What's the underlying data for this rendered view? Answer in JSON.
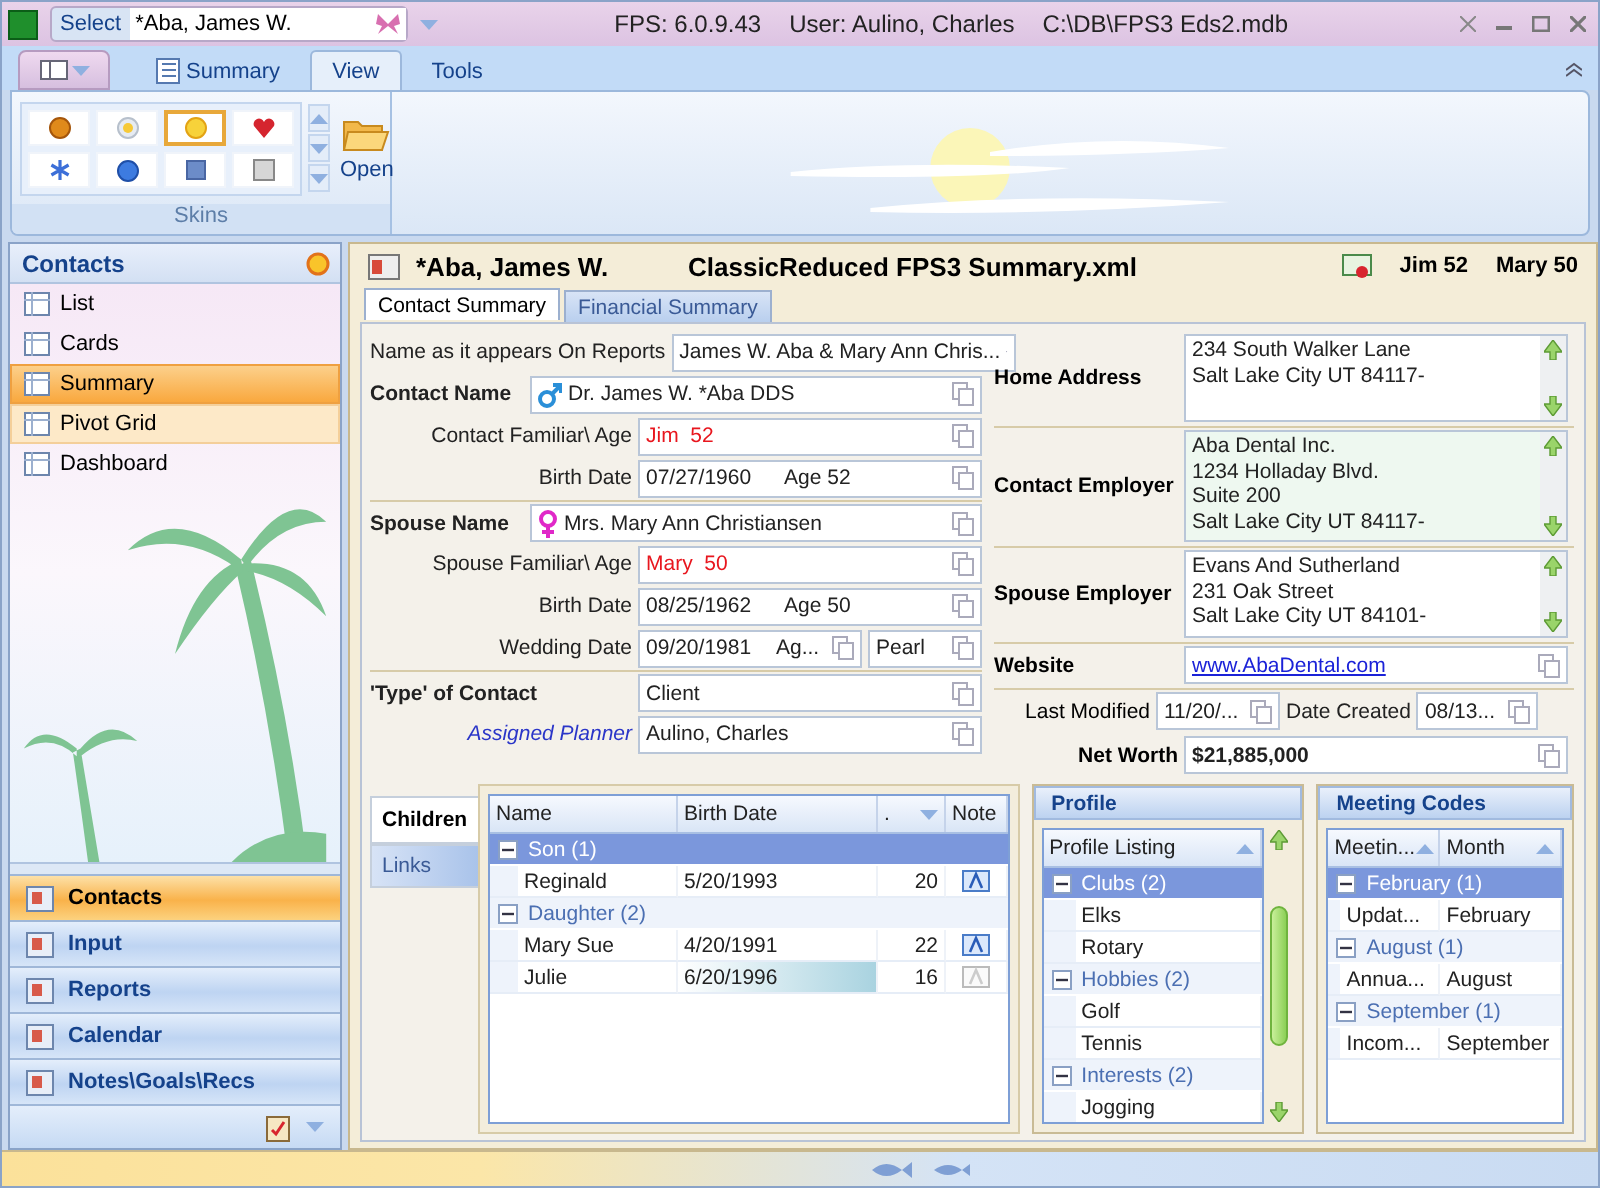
{
  "title_bar": {
    "select_label": "Select",
    "select_value": "*Aba, James W.",
    "version": "FPS: 6.0.9.43",
    "user": "User: Aulino, Charles",
    "path": "C:\\DB\\FPS3 Eds2.mdb"
  },
  "ribbon": {
    "tabs": [
      {
        "label": "Summary",
        "kind": "icon",
        "selected": false
      },
      {
        "label": "View",
        "kind": "plain",
        "selected": true
      },
      {
        "label": "Tools",
        "kind": "plain",
        "selected": false
      }
    ],
    "skins": [
      {
        "selected": false
      },
      {
        "selected": false
      },
      {
        "selected": true
      },
      {
        "selected": false
      },
      {
        "selected": false
      },
      {
        "selected": false
      },
      {
        "selected": false
      },
      {
        "selected": false
      }
    ],
    "open_label": "Open",
    "group_label": "Skins"
  },
  "sidebar": {
    "title": "Contacts",
    "views": [
      {
        "label": "List",
        "selected": false,
        "hot": false
      },
      {
        "label": "Cards",
        "selected": false,
        "hot": false
      },
      {
        "label": "Summary",
        "selected": true,
        "hot": false
      },
      {
        "label": "Pivot Grid",
        "selected": false,
        "hot": true
      },
      {
        "label": "Dashboard",
        "selected": false,
        "hot": false
      }
    ],
    "nav": [
      {
        "label": "Contacts",
        "selected": true
      },
      {
        "label": "Input",
        "selected": false
      },
      {
        "label": "Reports",
        "selected": false
      },
      {
        "label": "Calendar",
        "selected": false
      },
      {
        "label": "Notes\\Goals\\Recs",
        "selected": false
      }
    ]
  },
  "record": {
    "name": "*Aba, James W.",
    "layout": "ClassicReduced FPS3 Summary.xml",
    "badges": [
      "Jim 52",
      "Mary 50"
    ]
  },
  "tabs": [
    {
      "label": "Contact Summary",
      "selected": true
    },
    {
      "label": "Financial Summary",
      "selected": false
    }
  ],
  "left_fields": [
    {
      "kind": "text",
      "label": "Name as it appears On Reports",
      "value": "James W. Aba & Mary Ann Chris...",
      "alert": false
    },
    {
      "kind": "male_name",
      "label": "Contact Name",
      "value": "Dr. James W. *Aba DDS"
    },
    {
      "kind": "text",
      "label": "Contact Familiar\\ Age",
      "value": "Jim  52",
      "alert": true
    },
    {
      "kind": "date",
      "label": "Birth Date",
      "value": "07/27/1960",
      "age": "Age 52"
    },
    {
      "kind": "female_name",
      "label": "Spouse Name",
      "value": "Mrs. Mary Ann Christiansen"
    },
    {
      "kind": "text",
      "label": "Spouse Familiar\\ Age",
      "value": "Mary  50",
      "alert": true
    },
    {
      "kind": "date",
      "label": "Birth Date",
      "value": "08/25/1962",
      "age": "Age 50"
    },
    {
      "kind": "wedding",
      "label": "Wedding Date",
      "value": "09/20/1981",
      "age": "Ag...",
      "anniversary": "Pearl"
    },
    {
      "kind": "heading",
      "label": "'Type' of Contact",
      "value": "Client"
    },
    {
      "kind": "link",
      "label": "Assigned Planner",
      "value": "Aulino, Charles"
    }
  ],
  "right_fields": [
    {
      "kind": "address",
      "label": "Home Address",
      "lines": [
        "234 South Walker Lane",
        "Salt Lake City UT 84117-"
      ],
      "tinted": false
    },
    {
      "kind": "address",
      "label": "Contact Employer",
      "lines": [
        "Aba Dental Inc.",
        "1234 Holladay Blvd.",
        "Suite 200",
        "Salt Lake City UT 84117-"
      ],
      "tinted": true
    },
    {
      "kind": "address",
      "label": "Spouse Employer",
      "lines": [
        "Evans And Sutherland",
        "231 Oak Street",
        "Salt Lake City UT 84101-"
      ],
      "tinted": false
    },
    {
      "kind": "link",
      "label": "Website",
      "value": "www.AbaDental.com"
    },
    {
      "kind": "pair",
      "label": "Last Modified",
      "value": "11/20/...",
      "label2": "Date Created",
      "value2": "08/13..."
    },
    {
      "kind": "money",
      "label": "Net Worth",
      "value": "$21,885,000"
    }
  ],
  "children": {
    "side_tabs": [
      {
        "label": "Children",
        "selected": true
      },
      {
        "label": "Links",
        "selected": false
      }
    ],
    "columns": [
      {
        "label": "Name",
        "sorted": false
      },
      {
        "label": "Birth Date",
        "sorted": false
      },
      {
        "label": ".",
        "sorted": true,
        "descending": true
      },
      {
        "label": "Note",
        "sorted": false
      }
    ],
    "groups": [
      {
        "label": "Son (1)",
        "selected": true,
        "expanded": true,
        "rows": [
          {
            "name": "Reginald",
            "birth_date": "5/20/1993",
            "age": "20",
            "has_note": true,
            "focused": false
          }
        ]
      },
      {
        "label": "Daughter (2)",
        "selected": false,
        "expanded": true,
        "rows": [
          {
            "name": "Mary Sue",
            "birth_date": "4/20/1991",
            "age": "22",
            "has_note": true,
            "focused": false
          },
          {
            "name": "Julie",
            "birth_date": "6/20/1996",
            "age": "16",
            "has_note": false,
            "focused": true
          }
        ]
      }
    ]
  },
  "profile": {
    "title": "Profile",
    "column": {
      "label": "Profile Listing",
      "sorted": true,
      "descending": false
    },
    "groups": [
      {
        "label": "Clubs (2)",
        "selected": true,
        "expanded": true,
        "items": [
          "Elks",
          "Rotary"
        ]
      },
      {
        "label": "Hobbies (2)",
        "selected": false,
        "expanded": true,
        "items": [
          "Golf",
          "Tennis"
        ]
      },
      {
        "label": "Interests (2)",
        "selected": false,
        "expanded": true,
        "items": [
          "Jogging"
        ]
      }
    ]
  },
  "meeting_codes": {
    "title": "Meeting Codes",
    "columns": [
      {
        "label": "Meetin...",
        "sorted": true,
        "descending": false
      },
      {
        "label": "Month",
        "sorted": true,
        "descending": false
      }
    ],
    "groups": [
      {
        "label": "February (1)",
        "selected": true,
        "expanded": true,
        "rows": [
          [
            "Updat...",
            "February"
          ]
        ]
      },
      {
        "label": "August (1)",
        "selected": false,
        "expanded": true,
        "rows": [
          [
            "Annua...",
            "August"
          ]
        ]
      },
      {
        "label": "September (1)",
        "selected": false,
        "expanded": true,
        "rows": [
          [
            "Incom...",
            "September"
          ]
        ]
      }
    ]
  }
}
